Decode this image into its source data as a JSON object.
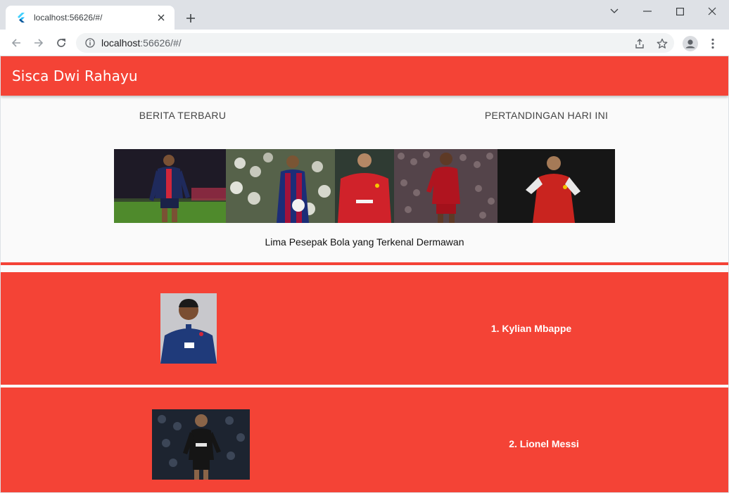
{
  "browser": {
    "tab_title": "localhost:56626/#/",
    "url_host": "localhost",
    "url_rest": ":56626/#/",
    "colors": {
      "tabstrip": "#dee1e6",
      "toolbar": "#ffffff"
    }
  },
  "app": {
    "title": "Sisca Dwi Rahayu",
    "accent": "#f44336",
    "tabs": [
      {
        "label": "BERITA TERBARU"
      },
      {
        "label": "PERTANDINGAN HARI INI"
      }
    ],
    "banner_caption": "Lima Pesepak Bola yang Terkenal Dermawan",
    "banner_photos": [
      {
        "icon": "player-photo-psg-icon"
      },
      {
        "icon": "player-photo-barcelona-icon"
      },
      {
        "icon": "player-photo-manutd-icon"
      },
      {
        "icon": "player-photo-liverpool-icon"
      },
      {
        "icon": "player-photo-arsenal-icon"
      }
    ],
    "players": [
      {
        "name": "1. Kylian Mbappe"
      },
      {
        "name": "2. Lionel Messi"
      }
    ]
  }
}
